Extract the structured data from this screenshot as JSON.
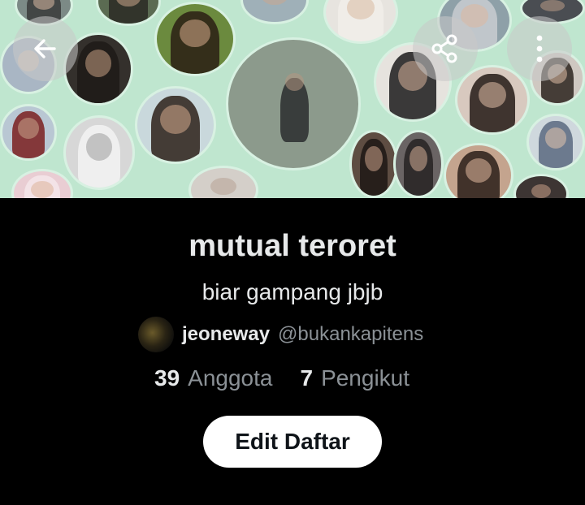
{
  "header": {
    "back_icon": "arrow-left-icon",
    "share_icon": "share-icon",
    "more_icon": "more-vertical-icon"
  },
  "list": {
    "name": "mutual teroret",
    "description": "biar gampang jbjb",
    "owner": {
      "display_name": "jeoneway",
      "handle": "@bukankapitens"
    },
    "members_count": "39",
    "members_label": "Anggota",
    "followers_count": "7",
    "followers_label": "Pengikut",
    "edit_button_label": "Edit Daftar"
  },
  "colors": {
    "background": "#000000",
    "banner_background": "#bfe6cf",
    "text_primary": "#e7e9ea",
    "text_secondary": "#8b9196",
    "button_background": "#ffffff",
    "button_text": "#0f1419"
  }
}
